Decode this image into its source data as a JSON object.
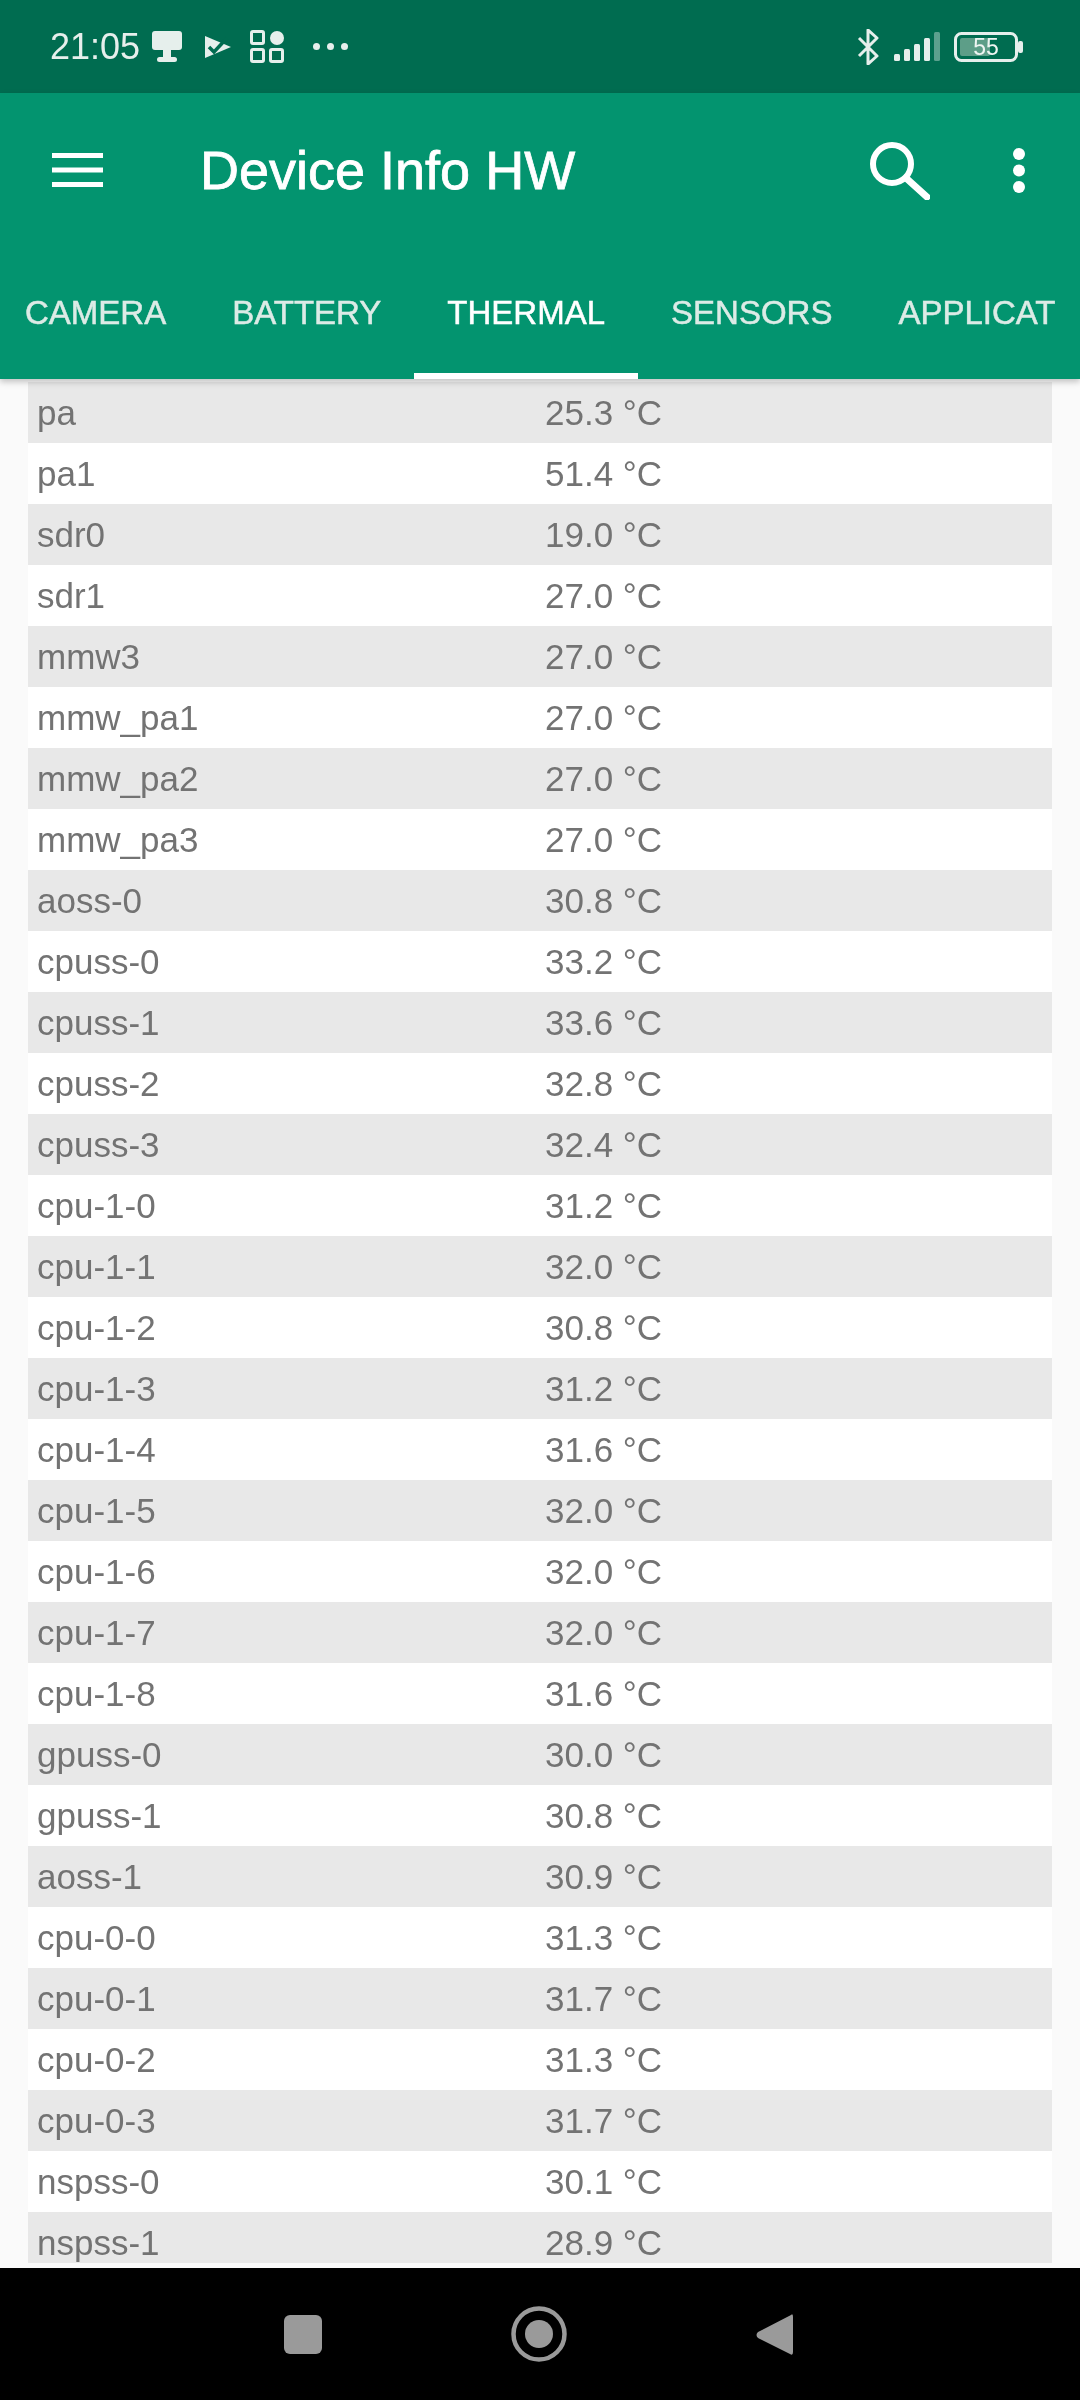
{
  "status_bar": {
    "time": "21:05",
    "battery": "55"
  },
  "app_bar": {
    "title": "Device Info HW"
  },
  "tabs": [
    {
      "label": "CAMERA",
      "selected": false
    },
    {
      "label": "BATTERY",
      "selected": false
    },
    {
      "label": "THERMAL",
      "selected": true
    },
    {
      "label": "SENSORS",
      "selected": false
    },
    {
      "label": "APPLICAT",
      "selected": false
    }
  ],
  "readings": [
    {
      "sensor": "pa",
      "temperature": "25.3 °C"
    },
    {
      "sensor": "pa1",
      "temperature": "51.4 °C"
    },
    {
      "sensor": "sdr0",
      "temperature": "19.0 °C"
    },
    {
      "sensor": "sdr1",
      "temperature": "27.0 °C"
    },
    {
      "sensor": "mmw3",
      "temperature": "27.0 °C"
    },
    {
      "sensor": "mmw_pa1",
      "temperature": "27.0 °C"
    },
    {
      "sensor": "mmw_pa2",
      "temperature": "27.0 °C"
    },
    {
      "sensor": "mmw_pa3",
      "temperature": "27.0 °C"
    },
    {
      "sensor": "aoss-0",
      "temperature": "30.8 °C"
    },
    {
      "sensor": "cpuss-0",
      "temperature": "33.2 °C"
    },
    {
      "sensor": "cpuss-1",
      "temperature": "33.6 °C"
    },
    {
      "sensor": "cpuss-2",
      "temperature": "32.8 °C"
    },
    {
      "sensor": "cpuss-3",
      "temperature": "32.4 °C"
    },
    {
      "sensor": "cpu-1-0",
      "temperature": "31.2 °C"
    },
    {
      "sensor": "cpu-1-1",
      "temperature": "32.0 °C"
    },
    {
      "sensor": "cpu-1-2",
      "temperature": "30.8 °C"
    },
    {
      "sensor": "cpu-1-3",
      "temperature": "31.2 °C"
    },
    {
      "sensor": "cpu-1-4",
      "temperature": "31.6 °C"
    },
    {
      "sensor": "cpu-1-5",
      "temperature": "32.0 °C"
    },
    {
      "sensor": "cpu-1-6",
      "temperature": "32.0 °C"
    },
    {
      "sensor": "cpu-1-7",
      "temperature": "32.0 °C"
    },
    {
      "sensor": "cpu-1-8",
      "temperature": "31.6 °C"
    },
    {
      "sensor": "gpuss-0",
      "temperature": "30.0 °C"
    },
    {
      "sensor": "gpuss-1",
      "temperature": "30.8 °C"
    },
    {
      "sensor": "aoss-1",
      "temperature": "30.9 °C"
    },
    {
      "sensor": "cpu-0-0",
      "temperature": "31.3 °C"
    },
    {
      "sensor": "cpu-0-1",
      "temperature": "31.7 °C"
    },
    {
      "sensor": "cpu-0-2",
      "temperature": "31.3 °C"
    },
    {
      "sensor": "cpu-0-3",
      "temperature": "31.7 °C"
    },
    {
      "sensor": "nspss-0",
      "temperature": "30.1 °C"
    },
    {
      "sensor": "nspss-1",
      "temperature": "28.9 °C"
    }
  ]
}
